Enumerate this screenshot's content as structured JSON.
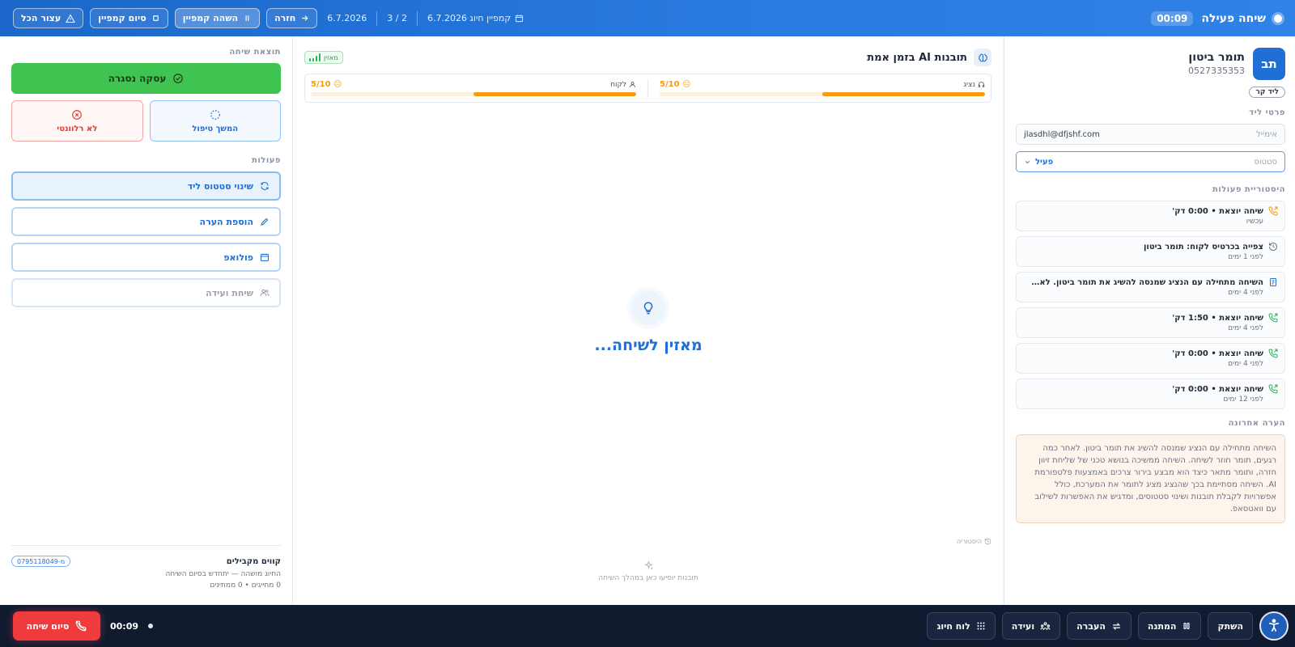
{
  "topbar": {
    "title": "שיחה פעילה",
    "timer": "00:09",
    "campaign": "קמפיין חיוג 6.7.2026",
    "counter": "2 / 3",
    "date": "6.7.2026",
    "back_label": "חזרה",
    "pause_label": "השהה קמפיין",
    "finish_label": "סיום קמפיין",
    "stop_all_label": "עצור הכל"
  },
  "lead": {
    "initials": "תב",
    "name": "תומר ביטון",
    "phone": "0527335353",
    "tag": "ליד קר",
    "details_label": "פרטי ליד",
    "email_label": "אימייל",
    "email": "jlasdhl@dfjshf.com",
    "status_label": "סטטוס",
    "status": "פעיל",
    "history_label": "היסטוריית פעולות",
    "history": [
      {
        "title": "שיחה יוצאת • 0:00 דק'",
        "time": "עכשיו",
        "icon": "phone-outgoing-icon"
      },
      {
        "title": "צפייה בכרטיס לקוח: תומר ביטון",
        "time": "לפני 1 ימים",
        "icon": "history-icon"
      },
      {
        "title": "השיחה מתחילה עם הנציג שמנסה להשיג את תומר ביטון. לאחר כמה רגעים, תומר חוזר לשיחה",
        "time": "לפני 4 ימים",
        "icon": "document-icon"
      },
      {
        "title": "שיחה יוצאת • 1:50 דק'",
        "time": "לפני 4 ימים",
        "icon": "phone-icon"
      },
      {
        "title": "שיחה יוצאת • 0:00 דק'",
        "time": "לפני 4 ימים",
        "icon": "phone-icon"
      },
      {
        "title": "שיחה יוצאת • 0:00 דק'",
        "time": "לפני 12 ימים",
        "icon": "phone-icon"
      }
    ],
    "last_note_label": "הערה אחרונה",
    "last_note": "השיחה מתחילה עם הנציג שמנסה להשיג את תומר ביטון. לאחר כמה רגעים, תומר חוזר לשיחה. השיחה ממשיכה בנושא טכני של שליחת זיוון חזרה, ותומר מתאר כיצד הוא מבצע בירור צרכים באמצעות פלטפורמת AI. השיחה מסתיימת בכך שהנציג מציג לתומר את המערכת, כולל אפשרויות לקבלת תובנות ושינוי סטטוסים, ומדגיש את האפשרות לשילוב עם וואטסאפ."
  },
  "insights": {
    "title": "תובנות AI בזמן אמת",
    "listening_badge": "מאזין",
    "agent_label": "נציג",
    "agent_score": "5/10",
    "agent_emoji": "😐",
    "agent_value": 0.5,
    "customer_label": "לקוח",
    "customer_score": "5/10",
    "customer_emoji": "😐",
    "customer_value": 0.5,
    "listening_text": "מאזין לשיחה...",
    "history_link": "היסטוריה",
    "empty_tips": "תובנות יופיעו כאן במהלך השיחה"
  },
  "outcome": {
    "label": "תוצאת שיחה",
    "deal_closed": "עסקה נסגרה",
    "follow_up": "המשך טיפול",
    "not_relevant": "לא רלוונטי",
    "actions_label": "פעולות",
    "actions": [
      {
        "label": "שינוי סטטוס ליד",
        "icon": "refresh-icon"
      },
      {
        "label": "הוספת הערה",
        "icon": "pencil-icon"
      },
      {
        "label": "פולואפ",
        "icon": "calendar-icon"
      },
      {
        "label": "שיחת ועידה",
        "icon": "users-icon"
      }
    ],
    "lines_title": "קווים מקבילים",
    "line_chip": "מ-0795118049",
    "lines_desc": "החיוג מושהה — יתחדש בסיום השיחה",
    "lines_stats": "0 מחייגים • 0 ממתינים"
  },
  "bottombar": {
    "mute": "השתק",
    "hold": "המתנה",
    "transfer": "העברה",
    "conference": "ועידה",
    "dialpad": "לוח חיוג",
    "timer": "00:09",
    "end_call": "סיום שיחה"
  },
  "colors": {
    "brand": "#1f6fd6",
    "success": "#3fc351",
    "danger": "#ef3b3b",
    "score": "#f39c12"
  }
}
